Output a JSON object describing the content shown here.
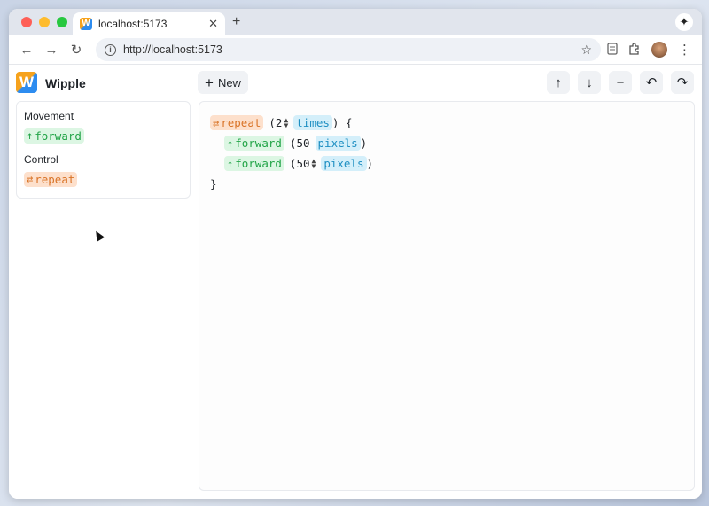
{
  "browser": {
    "tab_title": "localhost:5173",
    "tab_close": "✕",
    "new_tab": "+",
    "url": "http://localhost:5173",
    "info_symbol": "i",
    "gem_symbol": "✦",
    "star_symbol": "☆",
    "nav": {
      "back": "←",
      "forward": "→",
      "reload": "↻"
    },
    "kebab": "⋮"
  },
  "app": {
    "logo_letter": "W",
    "name": "Wipple",
    "new_button": {
      "icon": "+",
      "label": "New"
    },
    "tools": [
      {
        "name": "move-up",
        "icon": "↑"
      },
      {
        "name": "move-down",
        "icon": "↓"
      },
      {
        "name": "remove",
        "icon": "−"
      },
      {
        "name": "undo",
        "icon": "↶"
      },
      {
        "name": "redo",
        "icon": "↷"
      }
    ]
  },
  "palette": {
    "groups": [
      {
        "title": "Movement",
        "item": {
          "icon": "↑",
          "label": "forward"
        }
      },
      {
        "title": "Control",
        "item": {
          "icon": "⇄",
          "label": "repeat"
        }
      }
    ]
  },
  "editor": {
    "repeat": {
      "icon": "⇄",
      "label": "repeat",
      "open_paren": "(",
      "count": "2",
      "stepper": [
        "▲",
        "▼"
      ],
      "unit": "times",
      "close": ") {"
    },
    "lines": [
      {
        "icon": "↑",
        "label": "forward",
        "open_paren": "(",
        "value": "50",
        "unit": "pixels",
        "close": ")"
      },
      {
        "icon": "↑",
        "label": "forward",
        "open_paren": "(",
        "value": "50",
        "stepper": [
          "▲",
          "▼"
        ],
        "unit": "pixels",
        "close": ")"
      }
    ],
    "closing_brace": "}"
  },
  "colors": {
    "forward_bg": "#dcf6e3",
    "forward_fg": "#22a447",
    "repeat_bg": "#fde0cc",
    "repeat_fg": "#d97326",
    "unit_bg": "#d4effa",
    "unit_fg": "#1e8fc2"
  }
}
